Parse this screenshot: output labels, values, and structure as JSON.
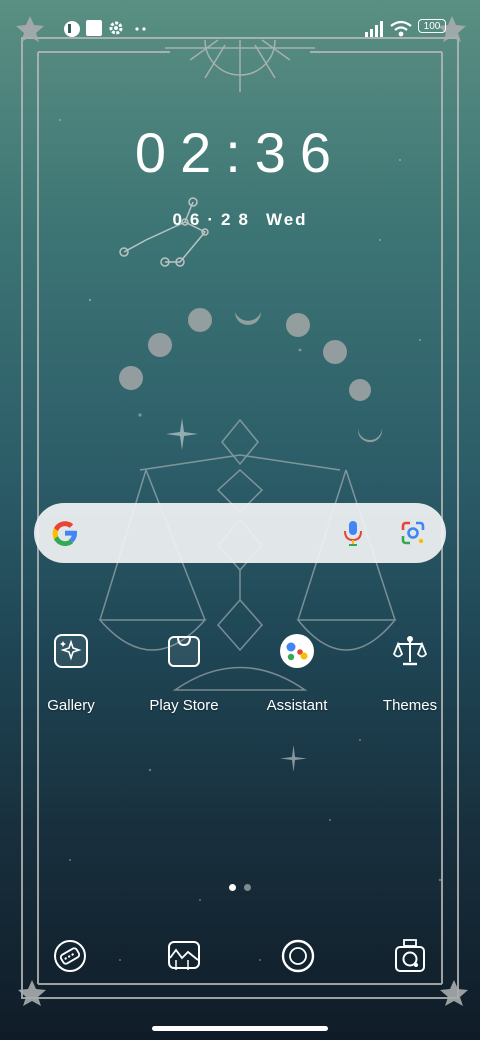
{
  "status_bar": {
    "battery": "100",
    "icons": [
      "notification-app-icon",
      "square-notification-icon",
      "settings-icon",
      "more-dots-icon",
      "signal-icon",
      "wifi-icon",
      "battery-icon"
    ]
  },
  "clock": {
    "time": "02:36",
    "date": "06·28",
    "weekday": "Wed"
  },
  "search_bar": {
    "icons": [
      "google-g-icon",
      "microphone-icon",
      "google-lens-icon"
    ]
  },
  "apps": [
    {
      "label": "Gallery",
      "icon": "gallery-icon"
    },
    {
      "label": "Play Store",
      "icon": "play-store-icon"
    },
    {
      "label": "Assistant",
      "icon": "assistant-icon"
    },
    {
      "label": "Themes",
      "icon": "themes-icon"
    }
  ],
  "page_indicator": {
    "pages": 2,
    "current": 1
  },
  "dock": [
    {
      "icon": "phone-icon"
    },
    {
      "icon": "messages-icon"
    },
    {
      "icon": "browser-icon"
    },
    {
      "icon": "camera-icon"
    }
  ],
  "colors": {
    "accent": "#ffffff",
    "frame": "#b5b8b9",
    "search_bg": "#f0f2f3"
  }
}
